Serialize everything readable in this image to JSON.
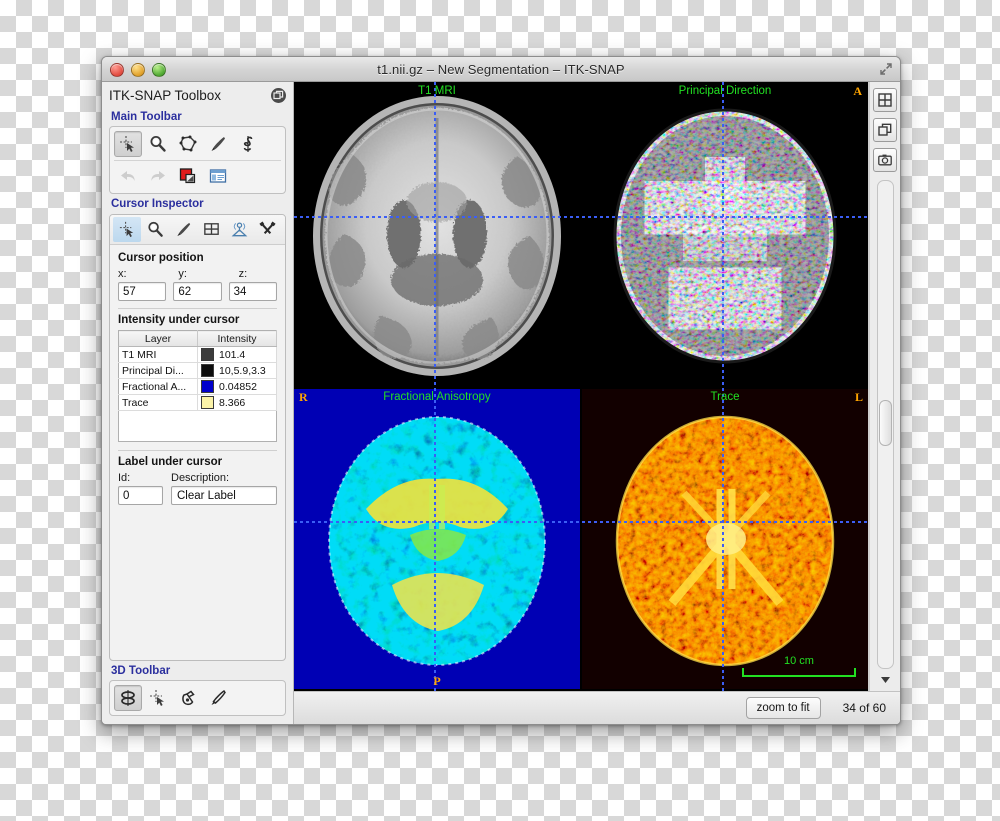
{
  "window": {
    "title": "t1.nii.gz – New Segmentation – ITK-SNAP",
    "controls": {
      "close": "close-button",
      "minimize": "minimize-button",
      "zoom": "zoom-button"
    }
  },
  "toolbox": {
    "title": "ITK-SNAP Toolbox",
    "detach_icon": "detach-panel-icon",
    "main_toolbar": {
      "title": "Main Toolbar",
      "row1": [
        {
          "name": "crosshair-tool",
          "active": true
        },
        {
          "name": "zoom-pan-tool",
          "active": false
        },
        {
          "name": "polygon-tool",
          "active": false
        },
        {
          "name": "paintbrush-tool",
          "active": false
        },
        {
          "name": "snake-tool",
          "active": false
        }
      ],
      "row2": [
        {
          "name": "undo-button",
          "disabled": true
        },
        {
          "name": "redo-button",
          "disabled": true
        },
        {
          "name": "active-label-swatch",
          "color": "#e01b1b"
        },
        {
          "name": "label-editor-button"
        }
      ]
    },
    "cursor_inspector": {
      "title": "Cursor Inspector",
      "tabs": [
        {
          "name": "tab-cursor-inspector",
          "icon": "crosshair-icon",
          "active": true
        },
        {
          "name": "tab-zoom-pan",
          "icon": "magnifier-icon",
          "active": false
        },
        {
          "name": "tab-paintbrush",
          "icon": "paintbrush-icon",
          "active": false
        },
        {
          "name": "tab-layers",
          "icon": "grid-icon",
          "active": false
        },
        {
          "name": "tab-3d",
          "icon": "antenna-icon",
          "active": false
        },
        {
          "name": "tab-tools",
          "icon": "hammers-icon",
          "active": false
        }
      ],
      "cursor_position": {
        "heading": "Cursor position",
        "x_label": "x:",
        "y_label": "y:",
        "z_label": "z:",
        "x": "57",
        "y": "62",
        "z": "34"
      },
      "intensity": {
        "heading": "Intensity under cursor",
        "columns": [
          "Layer",
          "Intensity"
        ],
        "rows": [
          {
            "layer": "T1 MRI",
            "color": "#3c3c3c",
            "value": "101.4"
          },
          {
            "layer": "Principal Di...",
            "color": "#0c0c0c",
            "value": "10,5.9,3.3"
          },
          {
            "layer": "Fractional A...",
            "color": "#0000cc",
            "value": "0.04852"
          },
          {
            "layer": "Trace",
            "color": "#fbf3a8",
            "value": "8.366"
          }
        ]
      },
      "label": {
        "heading": "Label under cursor",
        "id_label": "Id:",
        "description_label": "Description:",
        "id_value": "0",
        "description_value": "Clear Label"
      }
    },
    "toolbar_3d": {
      "title": "3D Toolbar",
      "buttons": [
        {
          "name": "trackball-tool",
          "active": true
        },
        {
          "name": "crosshair-3d-tool",
          "active": false
        },
        {
          "name": "spray-can-tool",
          "active": false
        },
        {
          "name": "scalpel-tool",
          "active": false
        }
      ]
    }
  },
  "viewer": {
    "panes": [
      {
        "name": "pane-t1-mri",
        "title": "T1 MRI",
        "orient_top": "A",
        "orient_left": "",
        "orient_right": "",
        "orient_bottom": ""
      },
      {
        "name": "pane-principal-direction",
        "title": "Principal Direction",
        "orient_top": "",
        "orient_left": "",
        "orient_right": "",
        "orient_bottom": ""
      },
      {
        "name": "pane-fractional-anisotropy",
        "title": "Fractional Anisotropy",
        "orient_top": "",
        "orient_left": "R",
        "orient_right": "",
        "orient_bottom": "P"
      },
      {
        "name": "pane-trace",
        "title": "Trace",
        "orient_top": "",
        "orient_left": "",
        "orient_right": "L",
        "orient_bottom": ""
      }
    ],
    "scale_bar": "10 cm",
    "rail_buttons": [
      {
        "name": "layout-grid-button",
        "icon": "grid-layout-icon"
      },
      {
        "name": "layout-window-button",
        "icon": "window-layers-icon"
      },
      {
        "name": "screenshot-button",
        "icon": "camera-icon"
      }
    ],
    "status": {
      "zoom_to_fit_label": "zoom to fit",
      "slice_counter": "34 of 60"
    }
  },
  "colors": {
    "accent_blue": "#2b2f9e",
    "pane_label_green": "#22e022",
    "orientation_orange": "#ffa500",
    "crosshair_blue": "#3b5ef5"
  }
}
